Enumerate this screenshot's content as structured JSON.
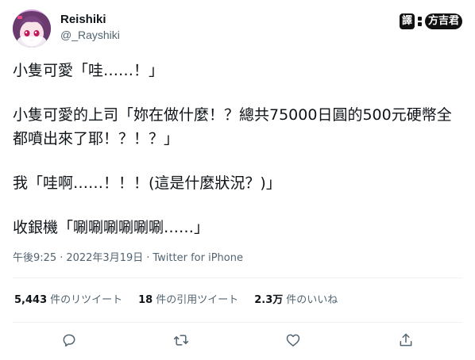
{
  "author": {
    "display_name": "Reishiki",
    "handle": "@_Rayshiki"
  },
  "translator_tag": {
    "label": "譯",
    "name": "方吉君"
  },
  "tweet": {
    "paragraphs": [
      "小隻可愛「哇……！」",
      "小隻可愛的上司「妳在做什麼！？總共75000日圓的500元硬幣全都噴出來了耶！？！？」",
      "我「哇啊……！！！(這是什麼狀況？)」",
      "收銀機「唰唰唰唰唰唰……」"
    ],
    "time": "午後9:25",
    "date": "2022年3月19日",
    "source": "Twitter for iPhone",
    "dot": "·"
  },
  "stats": {
    "retweets_count": "5,443",
    "retweets_label": "件のリツイート",
    "quotes_count": "18",
    "quotes_label": "件の引用ツイート",
    "likes_count": "2.3万",
    "likes_label": "件のいいね"
  },
  "icons": {
    "reply": "reply-icon",
    "retweet": "retweet-icon",
    "like": "like-icon",
    "share": "share-icon"
  },
  "colors": {
    "text": "#0f1419",
    "muted": "#536471",
    "divider": "#eff3f4",
    "icon": "#536471"
  }
}
